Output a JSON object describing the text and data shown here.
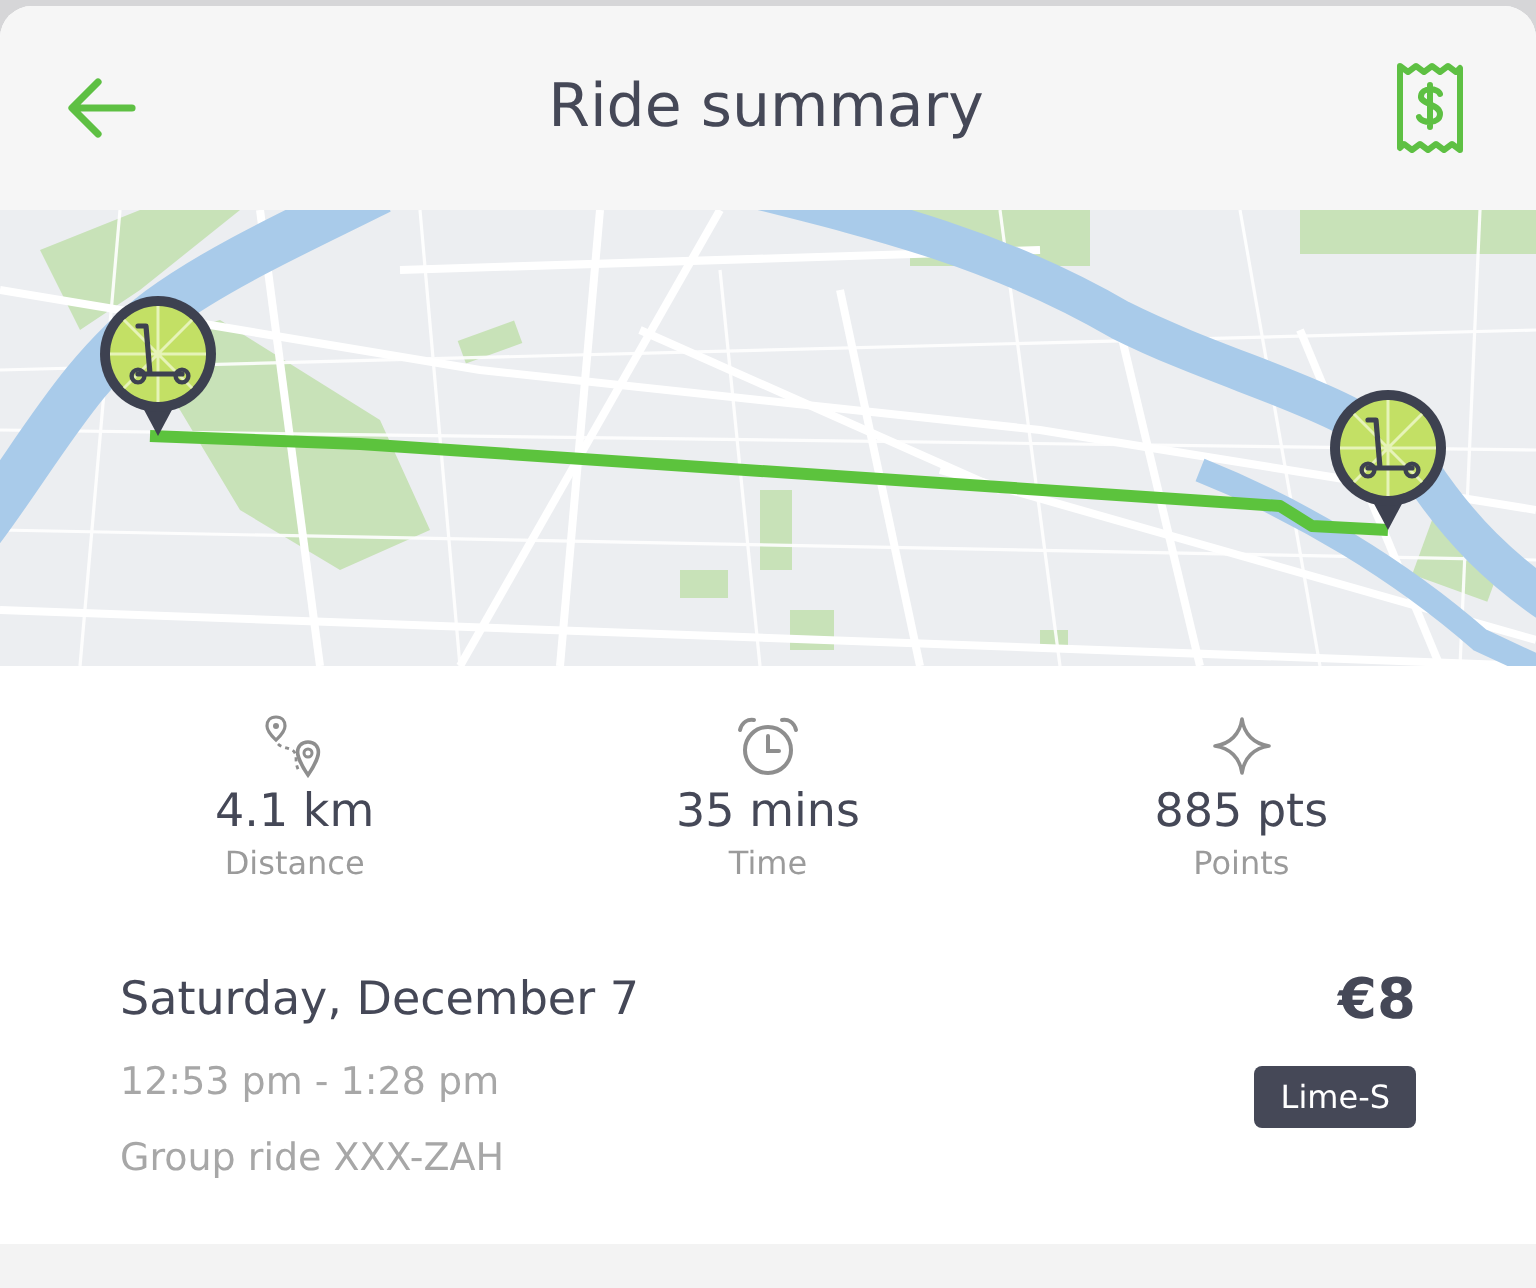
{
  "header": {
    "title": "Ride summary"
  },
  "stats": [
    {
      "kind": "distance",
      "value": "4.1 km",
      "label": "Distance"
    },
    {
      "kind": "time",
      "value": "35 mins",
      "label": "Time"
    },
    {
      "kind": "points",
      "value": "885 pts",
      "label": "Points"
    }
  ],
  "ride": {
    "date": "Saturday, December 7",
    "price": "€8",
    "time_range": "12:53 pm - 1:28 pm",
    "vehicle": "Lime-S",
    "group": "Group ride XXX-ZAH"
  }
}
